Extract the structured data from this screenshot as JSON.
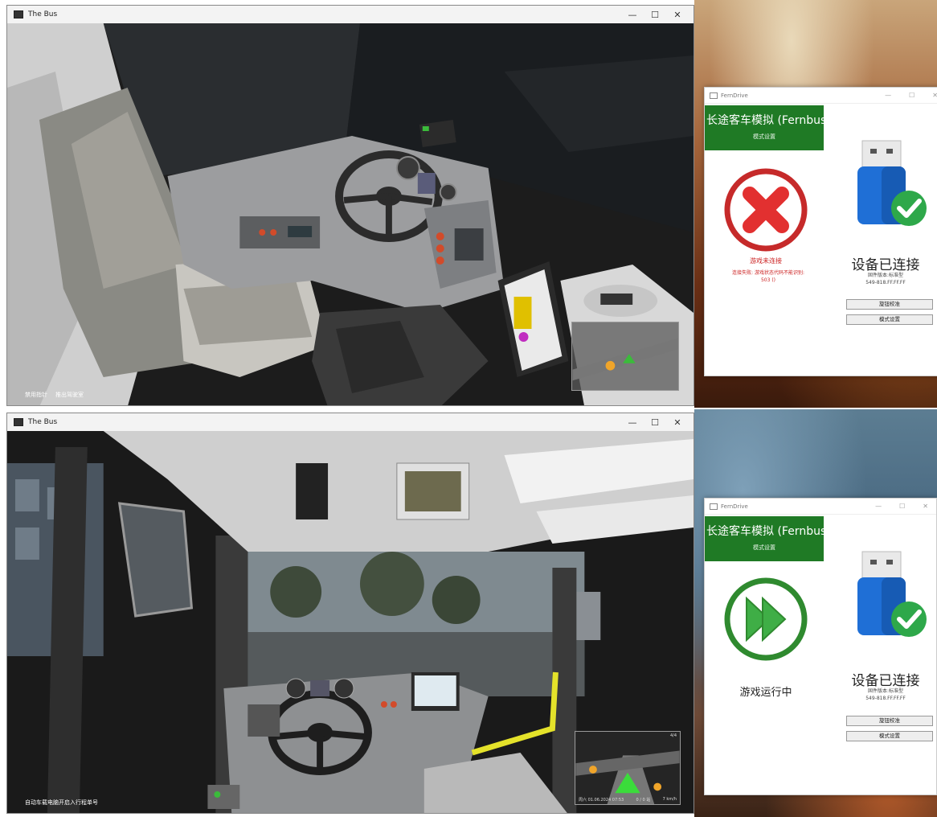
{
  "top": {
    "game_window": {
      "title": "The Bus",
      "controls": {
        "minimize": "—",
        "maximize": "☐",
        "close": "✕"
      },
      "hud": {
        "hint_left": "禁用指针",
        "hint_right": "推出驾驶室"
      }
    },
    "app": {
      "title": "FernDrive",
      "controls": {
        "minimize": "—",
        "maximize": "☐",
        "close": "✕"
      },
      "game_name": "长途客车模拟 (Fernbus)",
      "mode_label": "模式设置",
      "status_text": "游戏未连接",
      "error_detail": "连接失败: 游戏状态代码不能识别:",
      "error_code": "503 ()",
      "status_color": "#d32b2b",
      "device_status": "设备已连接",
      "device_model": "固件版本:标准型",
      "device_id": "549-818.FF.FF.FF",
      "button_calibrate": "旋钮校准",
      "button_mode": "模式设置",
      "usb_color": "#1f6fd6",
      "check_color": "#2ea84a"
    }
  },
  "bottom": {
    "game_window": {
      "title": "The Bus",
      "controls": {
        "minimize": "—",
        "maximize": "☐",
        "close": "✕"
      },
      "hud": {
        "hint_left": "自动车载电脑开启入行程单号"
      },
      "minimap": {
        "top_right": "4/4",
        "status_left": "周六 01.06.2024 07:53",
        "status_mid": "0 / 0 站",
        "status_right": "7 km/h"
      }
    },
    "app": {
      "title": "FernDrive",
      "controls": {
        "minimize": "—",
        "maximize": "☐",
        "close": "✕"
      },
      "game_name": "长途客车模拟 (Fernbus)",
      "mode_label": "模式设置",
      "status_text": "游戏运行中",
      "status_color": "#2f8a2f",
      "device_status": "设备已连接",
      "device_model": "固件版本:标准型",
      "device_id": "549-818.FF.FF.FF",
      "button_calibrate": "旋钮校准",
      "button_mode": "模式设置",
      "usb_color": "#1f6fd6",
      "check_color": "#2ea84a"
    }
  }
}
